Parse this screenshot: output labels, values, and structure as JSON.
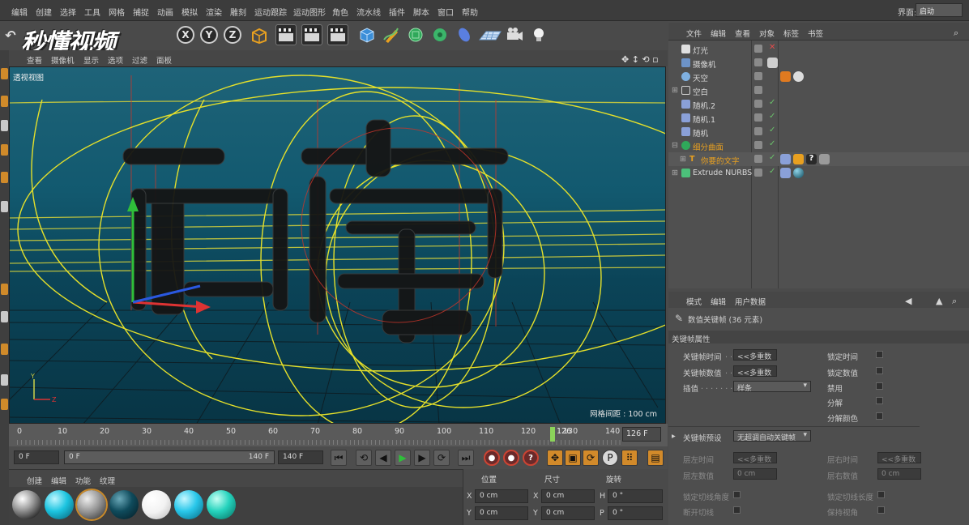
{
  "menu": {
    "items": [
      "编辑",
      "创建",
      "选择",
      "工具",
      "网格",
      "捕捉",
      "动画",
      "模拟",
      "渲染",
      "雕刻",
      "运动跟踪",
      "运动图形",
      "角色",
      "流水线",
      "插件",
      "脚本",
      "窗口",
      "帮助"
    ],
    "layout_label": "界面:",
    "layout_value": "启动"
  },
  "watermark": "秒懂视频",
  "toolbar": {
    "axis_x": "X",
    "axis_y": "Y",
    "axis_z": "Z"
  },
  "viewport": {
    "menu": [
      "查看",
      "摄像机",
      "显示",
      "选项",
      "过滤",
      "面板"
    ],
    "label": "透视视图",
    "grid_readout": "网格间距 : 100 cm",
    "colors": {
      "sky_top": "#1e6378",
      "sky_bottom": "#083545",
      "spline": "#e5e02a",
      "wire": "#c9362a"
    }
  },
  "timeline": {
    "ticks": [
      "0",
      "10",
      "20",
      "30",
      "40",
      "50",
      "60",
      "70",
      "80",
      "90",
      "100",
      "110",
      "120",
      "130",
      "140"
    ],
    "current_frame_label": "126",
    "end_box": "126 F"
  },
  "transport": {
    "start_field": "0 F",
    "slider_left": "0 F",
    "slider_right": "140 F",
    "end_field": "140 F"
  },
  "materials": {
    "menu": [
      "创建",
      "编辑",
      "功能",
      "纹理"
    ]
  },
  "coordinates": {
    "headers": [
      "位置",
      "尺寸",
      "旋转"
    ],
    "rows": [
      {
        "axis1": "X",
        "pos": "0 cm",
        "axis2": "X",
        "size": "0 cm",
        "axis3": "H",
        "rot": "0 °"
      },
      {
        "axis1": "Y",
        "pos": "0 cm",
        "axis2": "Y",
        "size": "0 cm",
        "axis3": "P",
        "rot": "0 °"
      }
    ]
  },
  "object_manager": {
    "menu": [
      "文件",
      "编辑",
      "查看",
      "对象",
      "标签",
      "书签"
    ],
    "objects": [
      {
        "name": "灯光",
        "icon": "light-icon",
        "color": "#e0e0e0",
        "status": "x"
      },
      {
        "name": "摄像机",
        "icon": "camera-icon",
        "color": "#6d93c8",
        "status": ""
      },
      {
        "name": "天空",
        "icon": "sky-icon",
        "color": "#7fb0e0",
        "status": ""
      },
      {
        "name": "空白",
        "icon": "null-icon",
        "color": "#d0d0d0",
        "status": ""
      },
      {
        "name": "随机.2",
        "icon": "random-icon",
        "color": "#8aa0d8",
        "status": "check"
      },
      {
        "name": "随机.1",
        "icon": "random-icon",
        "color": "#8aa0d8",
        "status": "check"
      },
      {
        "name": "随机",
        "icon": "random-icon",
        "color": "#8aa0d8",
        "status": "check"
      },
      {
        "name": "细分曲面",
        "icon": "subdivision-icon",
        "color": "#e0a020",
        "status": "check"
      },
      {
        "name": "你要的文字",
        "icon": "text-spline-icon",
        "color": "#e0a020",
        "status": "check"
      },
      {
        "name": "Extrude NURBS",
        "icon": "extrude-icon",
        "color": "#4cc07a",
        "status": "check"
      }
    ]
  },
  "attributes": {
    "menu": [
      "模式",
      "编辑",
      "用户数据"
    ],
    "title": "数值关键帧 (36 元素)",
    "section": "关键帧属性",
    "fields_left": [
      {
        "label": "关键帧时间",
        "value": "<<多重数"
      },
      {
        "label": "关键帧数值",
        "value": "<<多重数"
      },
      {
        "label": "插值",
        "value": "样条"
      }
    ],
    "fields_right": [
      "锁定时间",
      "锁定数值",
      "禁用",
      "分解",
      "分解颜色"
    ],
    "preset_label": "关键帧预设",
    "preset_value": "无超调自动关键帧",
    "lower_left": [
      {
        "label": "层左时间",
        "value": "<<多重数"
      },
      {
        "label": "层左数值",
        "value": "0 cm"
      }
    ],
    "lower_right": [
      {
        "label": "层右时间",
        "value": "<<多重数"
      },
      {
        "label": "层右数值",
        "value": "0 cm"
      }
    ],
    "bottom_left": [
      "锁定切线角度",
      "断开切线"
    ],
    "bottom_right": [
      "锁定切线长度",
      "保持视角"
    ]
  }
}
